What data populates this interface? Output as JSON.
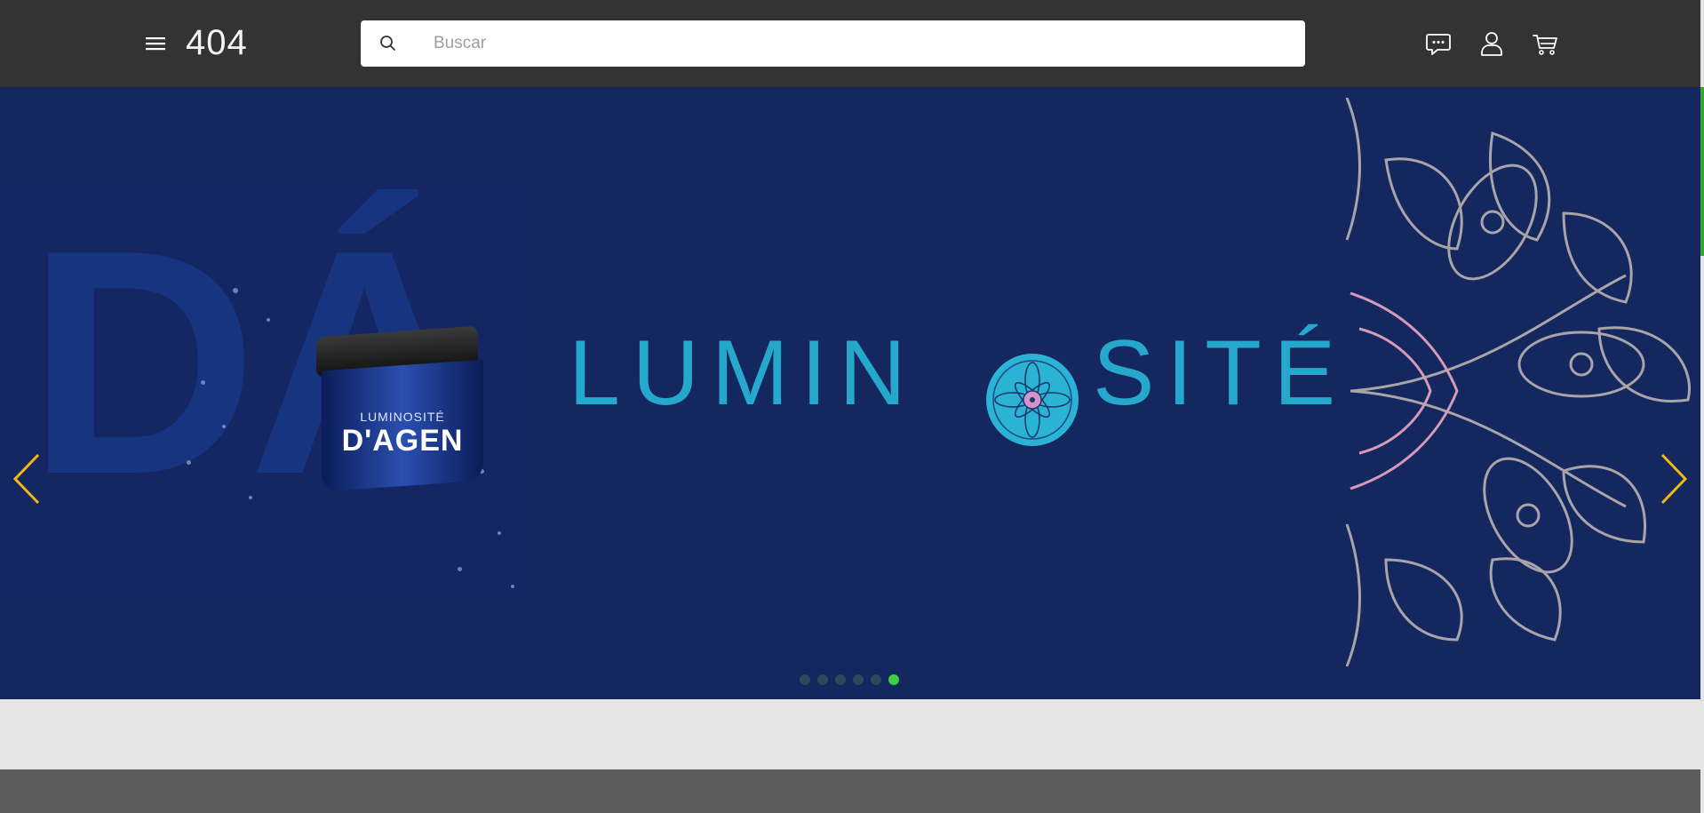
{
  "header": {
    "logo_text": "404",
    "menu_icon": "hamburger-menu-icon",
    "search": {
      "placeholder": "Buscar",
      "value": "",
      "icon": "search-icon"
    },
    "actions": [
      {
        "name": "chat-icon"
      },
      {
        "name": "user-icon"
      },
      {
        "name": "cart-icon"
      }
    ]
  },
  "hero": {
    "product_brand": "LUMINOSITÉ",
    "product_name": "D'AGEN",
    "title_left": "LUMIN",
    "title_right": "SITÉ",
    "background_color": "#14275f",
    "title_color": "#25a8cc",
    "arrow_color": "#f2b90f",
    "prev_icon": "chevron-left-icon",
    "next_icon": "chevron-right-icon",
    "slides_count": 6,
    "active_slide": 6
  },
  "colors": {
    "header_bg": "#333333",
    "page_bg": "#e6e6e6",
    "footer_bg": "#5c5c5c",
    "dot_active": "#3ccf48",
    "dot_inactive": "#2a4a5a"
  }
}
